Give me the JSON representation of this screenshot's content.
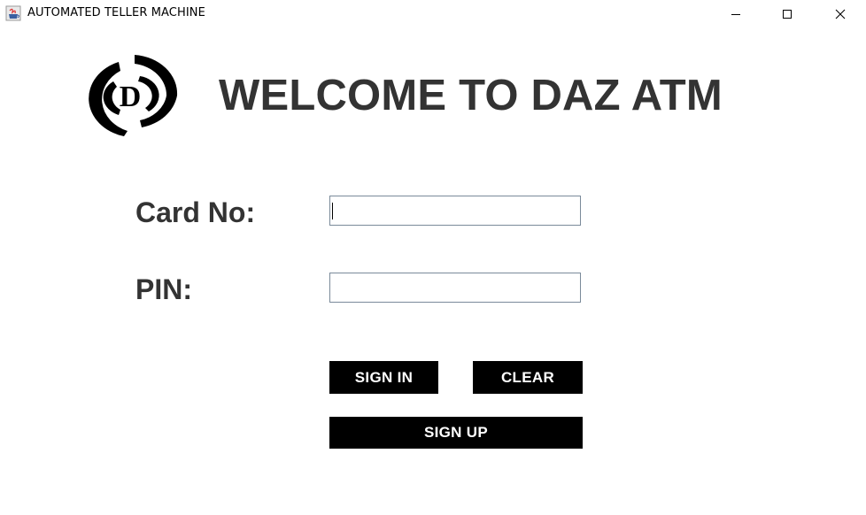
{
  "window": {
    "title": "AUTOMATED TELLER MACHINE",
    "icon": "java-cup-icon",
    "controls": {
      "minimize": "minimize-icon",
      "maximize": "maximize-icon",
      "close": "close-icon"
    }
  },
  "header": {
    "logo_letter": "D",
    "welcome_text": "WELCOME TO DAZ ATM"
  },
  "form": {
    "card_label": "Card No:",
    "card_value": "",
    "pin_label": "PIN:",
    "pin_value": ""
  },
  "buttons": {
    "sign_in": "SIGN IN",
    "clear": "CLEAR",
    "sign_up": "SIGN UP"
  },
  "colors": {
    "text": "#333333",
    "button_bg": "#000000",
    "button_text": "#ffffff",
    "field_border": "#7a8a9a"
  }
}
